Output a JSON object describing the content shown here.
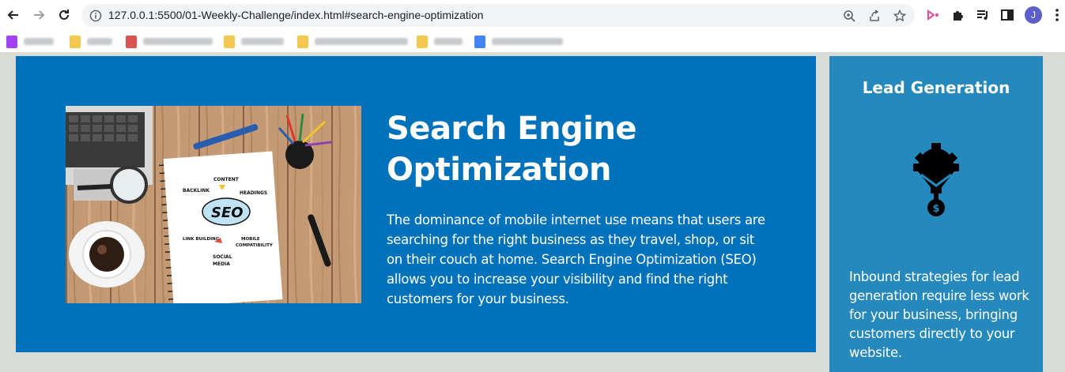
{
  "browser": {
    "url": "127.0.0.1:5500/01-Weekly-Challenge/index.html#search-engine-optimization",
    "avatar_letter": "J",
    "bookmarks": [
      {
        "favicon_color": "#a142f4"
      },
      {
        "favicon_color": "#f4c74f"
      },
      {
        "favicon_color": "#d9534f"
      },
      {
        "favicon_color": "#f4c74f"
      },
      {
        "favicon_color": "#f4c74f"
      },
      {
        "favicon_color": "#f4c74f"
      },
      {
        "favicon_color": "#4285f4"
      }
    ]
  },
  "seo": {
    "title": "Search Engine Optimization",
    "description": "The dominance of mobile internet use means that users are searching for the right business as they travel, shop, or sit on their couch at home. Search Engine Optimization (SEO) allows you to increase your visibility and find the right customers for your business.",
    "image_labels": {
      "content": "CONTENT",
      "backlink": "BACKLINK",
      "headings": "HEADINGS",
      "seo": "SEO",
      "link_building": "LINK BUILDING",
      "mobile": "MOBILE",
      "compatibility": "COMPATIBILITY",
      "social": "SOCIAL",
      "media": "MEDIA"
    }
  },
  "lead": {
    "title": "Lead Generation",
    "description": "Inbound strategies for lead generation require less work for your business, bringing customers directly to your website."
  },
  "colors": {
    "seo_bg": "#0072bb",
    "lead_bg": "#2589bd",
    "page_bg": "#d9dbd6"
  }
}
